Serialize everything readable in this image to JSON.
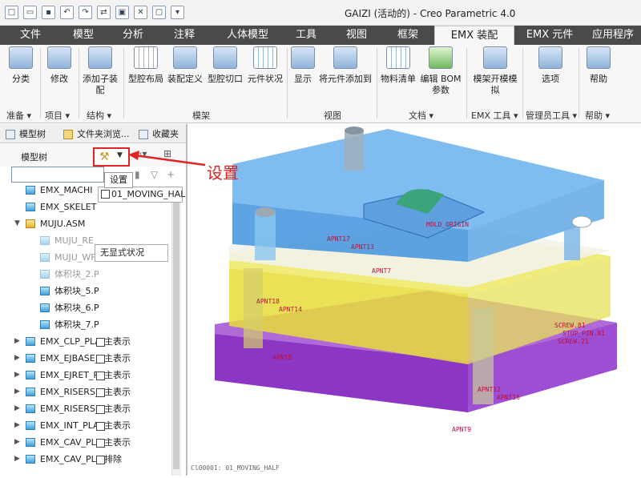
{
  "window": {
    "title": "GAIZI (活动的) - Creo Parametric 4.0"
  },
  "qat": [
    "□",
    "▭",
    "▪",
    "↶",
    "↷",
    "⇄",
    "▣",
    "✕",
    "▢",
    "▾"
  ],
  "tabs": [
    "文件",
    "模型",
    "分析",
    "注释",
    "人体模型",
    "工具",
    "视图",
    "框架",
    "EMX 装配",
    "EMX 元件",
    "应用程序"
  ],
  "active_tab": "EMX 装配",
  "ribbon": {
    "buttons": [
      "分类",
      "修改",
      "添加子装配",
      "型腔布局",
      "装配定义",
      "型腔切口",
      "元件状况",
      "显示",
      "将元件添加到",
      "物料清单",
      "编辑 BOM 参数",
      "模架开模模拟",
      "选项",
      "帮助"
    ],
    "groups": [
      "准备 ▾",
      "项目 ▾",
      "结构 ▾",
      "模架",
      "视图",
      "文档 ▾",
      "EMX 工具 ▾",
      "管理员工具 ▾",
      "帮助 ▾"
    ]
  },
  "panel": {
    "tabs": [
      "模型树",
      "文件夹浏览...",
      "收藏夹"
    ],
    "tree_title": "模型树",
    "search_placeholder": "",
    "tooltip": "设置",
    "moving_half": "01_MOVING_HAL",
    "show_state": "无显式状况",
    "rows": [
      {
        "label": "EMX_MACHI",
        "icon": "part"
      },
      {
        "label": "EMX_SKELET",
        "icon": "part"
      },
      {
        "label": "MUJU.ASM",
        "icon": "asm"
      },
      {
        "label": "MUJU_RE",
        "icon": "part-dim"
      },
      {
        "label": "MUJU_WF",
        "icon": "part-dim"
      },
      {
        "label": "体积块_2.P",
        "icon": "part-dim"
      },
      {
        "label": "体积块_5.P",
        "icon": "part"
      },
      {
        "label": "体积块_6.P",
        "icon": "part"
      },
      {
        "label": "体积块_7.P",
        "icon": "part"
      },
      {
        "label": "EMX_CLP_PLA",
        "icon": "part",
        "tag": "主表示"
      },
      {
        "label": "EMX_EJBASE_",
        "icon": "part",
        "tag": "主表示"
      },
      {
        "label": "EMX_EJRET_P",
        "icon": "part",
        "tag": "主表示"
      },
      {
        "label": "EMX_RISERS_",
        "icon": "part",
        "tag": "主表示"
      },
      {
        "label": "EMX_RISERS_",
        "icon": "part",
        "tag": "主表示"
      },
      {
        "label": "EMX_INT_PLA",
        "icon": "part",
        "tag": "主表示"
      },
      {
        "label": "EMX_CAV_PLA",
        "icon": "part",
        "tag": "主表示"
      },
      {
        "label": "EMX_CAV_PL",
        "icon": "part",
        "tag": "排除"
      }
    ]
  },
  "annotation": {
    "label": "设置",
    "color": "#e02424"
  },
  "viewport": {
    "points": [
      "APNT17",
      "APNT13",
      "APNT7",
      "APNT18",
      "APNT14",
      "APNT8",
      "APNT12",
      "APNT16",
      "APNT9",
      "SCREW.81",
      "STOP_PIN.81",
      "SCREW.21",
      "MOLD_ORIGIN"
    ],
    "status": "Cl00001: 01_MOVING_HALF"
  }
}
